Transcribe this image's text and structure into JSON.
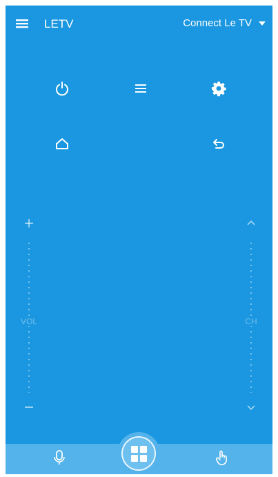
{
  "header": {
    "title": "LETV",
    "connect_label": "Connect Le TV"
  },
  "icons": {
    "menu": "hamburger-menu-icon",
    "dropdown": "caret-down-icon",
    "power": "power-icon",
    "tv_menu": "list-menu-icon",
    "settings": "gear-icon",
    "home": "home-icon",
    "back": "return-icon",
    "volume_up": "plus-icon",
    "volume_down": "minus-icon",
    "channel_up": "chevron-up-icon",
    "channel_down": "chevron-down-icon",
    "voice": "microphone-icon",
    "apps": "apps-grid-icon",
    "touch": "hand-pointer-icon"
  },
  "volume": {
    "label": "VOL"
  },
  "channel": {
    "label": "CH"
  },
  "colors": {
    "background": "#1a97e0",
    "bottom_bar": "#54b3ea",
    "foreground": "#ffffff"
  }
}
